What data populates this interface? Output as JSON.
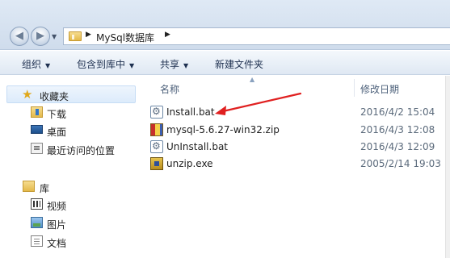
{
  "address": {
    "path_segment": "MySql数据库"
  },
  "toolbar": {
    "organize": "组织",
    "include_in_library": "包含到库中",
    "share": "共享",
    "new_folder": "新建文件夹"
  },
  "nav": {
    "favorites": "收藏夹",
    "downloads": "下载",
    "desktop": "桌面",
    "recent": "最近访问的位置",
    "libraries": "库",
    "videos": "视频",
    "pictures": "图片",
    "documents": "文档"
  },
  "columns": {
    "name": "名称",
    "date_modified": "修改日期"
  },
  "files": [
    {
      "name": "Install.bat",
      "date": "2016/4/2 15:04",
      "icon": "batch-file-icon"
    },
    {
      "name": "mysql-5.6.27-win32.zip",
      "date": "2016/4/3 12:08",
      "icon": "zip-archive-icon"
    },
    {
      "name": "UnInstall.bat",
      "date": "2016/4/3 12:09",
      "icon": "batch-file-icon"
    },
    {
      "name": "unzip.exe",
      "date": "2005/2/14 19:03",
      "icon": "exe-file-icon"
    }
  ],
  "annotation": {
    "arrow_color": "#e02020"
  }
}
